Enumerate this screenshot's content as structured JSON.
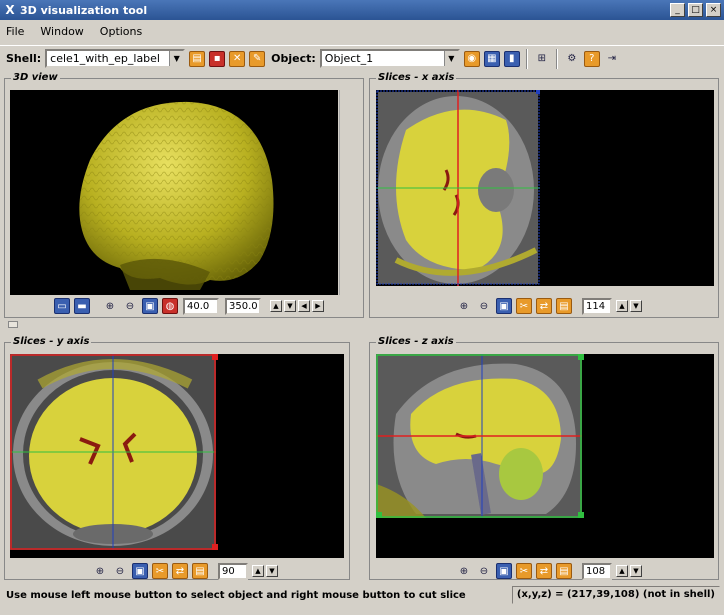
{
  "window": {
    "title": "3D visualization tool",
    "app_icon": "X",
    "buttons": [
      "_",
      "□",
      "×"
    ]
  },
  "menu": [
    "File",
    "Window",
    "Options"
  ],
  "toolbar": {
    "shell_label": "Shell:",
    "shell_value": "cele1_with_ep_label",
    "object_label": "Object:",
    "object_value": "Object_1"
  },
  "panels": {
    "view3d": {
      "title": "3D view",
      "min": "40.0",
      "max": "350.0"
    },
    "slice_x": {
      "title": "Slices - x axis",
      "value": "114"
    },
    "slice_y": {
      "title": "Slices - y axis",
      "value": "90"
    },
    "slice_z": {
      "title": "Slices - z axis",
      "value": "108"
    }
  },
  "status": {
    "message": "Use mouse left mouse button to select object and right mouse button to cut slice",
    "coords": "(x,y,z) = (217,39,108) (not in shell)"
  },
  "colors": {
    "tissue": "#d8d23c",
    "lesion": "#8a1a10",
    "cross_red": "#e02020",
    "cross_green": "#30c040",
    "cross_blue": "#2040c0"
  }
}
